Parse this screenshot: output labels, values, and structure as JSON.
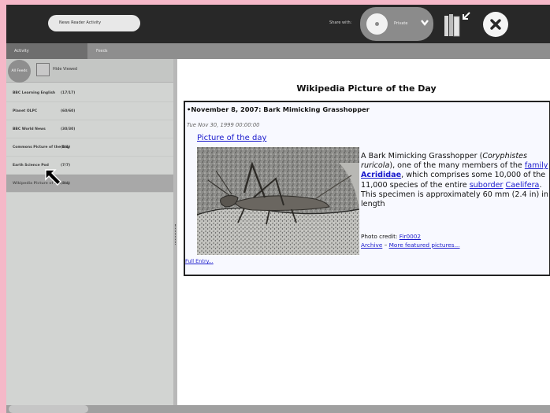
{
  "toolbar": {
    "activity_title": "News Reader Activity",
    "share_label": "Share with:",
    "share_value": "Private"
  },
  "tabs": [
    {
      "label": "Activity"
    },
    {
      "label": "Feeds"
    }
  ],
  "sidebar": {
    "all_feeds_label": "All Feeds",
    "hide_viewed_label": "Hide Viewed",
    "feeds": [
      {
        "name": "BBC Learning English",
        "count": "(17/17)"
      },
      {
        "name": "Planet OLPC",
        "count": "(60/60)"
      },
      {
        "name": "BBC World News",
        "count": "(30/30)"
      },
      {
        "name": "Commons Picture of the Day",
        "count": "(1/1)"
      },
      {
        "name": "Earth Science Pod",
        "count": "(7/7)"
      },
      {
        "name": "Wikipedia Picture of the Day",
        "count": "(4/4)"
      }
    ]
  },
  "content": {
    "page_title": "Wikipedia Picture of the Day",
    "article_title": "November 8, 2007: Bark Mimicking Grasshopper",
    "date": "Tue Nov 30, 1999 00:00:00",
    "picture_link": "Picture of the day",
    "desc": {
      "t1": "A Bark Mimicking Grasshopper (",
      "species": "Coryphistes ruricola",
      "t2": "), one of the many members of the ",
      "family_link": "family",
      "family_name": "Acrididae",
      "t3": ", which comprises some 10,000 of the 11,000 species of the entire ",
      "suborder_link": "suborder",
      "suborder_name": "Caelifera",
      "t4": ". This specimen is approximately 60 mm (2.4 in) in length"
    },
    "credit_label": "Photo credit: ",
    "credit_author": "Fir0002",
    "archive_link": "Archive",
    "sep": " – ",
    "more_link": "More featured pictures...",
    "full_entry": "Full Entry..."
  }
}
